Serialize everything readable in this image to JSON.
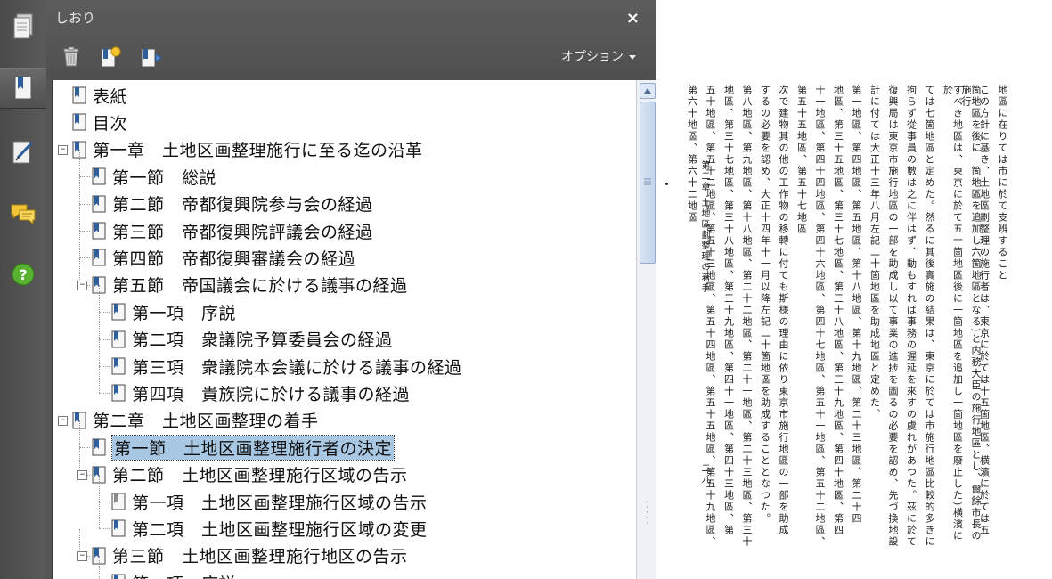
{
  "panel": {
    "title": "しおり",
    "close_label": "×",
    "options_label": "オプション"
  },
  "sidebar": {
    "icons": [
      "pages-icon",
      "bookmarks-icon",
      "signature-icon",
      "comments-icon",
      "help-icon"
    ]
  },
  "toolbar": {
    "icons": [
      "delete-icon",
      "new-bookmark-icon",
      "expand-bookmark-icon"
    ]
  },
  "tree": {
    "items": [
      {
        "label": "表紙",
        "level": 0,
        "expander": "",
        "icon": "bookmark"
      },
      {
        "label": "目次",
        "level": 0,
        "expander": "",
        "icon": "bookmark"
      },
      {
        "label": "第一章　土地区画整理施行に至る迄の沿革",
        "level": 0,
        "expander": "−",
        "icon": "bookmark"
      },
      {
        "label": "第一節　総説",
        "level": 1,
        "expander": "",
        "icon": "bookmark"
      },
      {
        "label": "第二節　帝都復興院参与会の経過",
        "level": 1,
        "expander": "",
        "icon": "bookmark"
      },
      {
        "label": "第三節　帝都復興院評議会の経過",
        "level": 1,
        "expander": "",
        "icon": "bookmark"
      },
      {
        "label": "第四節　帝都復興審議会の経過",
        "level": 1,
        "expander": "",
        "icon": "bookmark"
      },
      {
        "label": "第五節　帝国議会に於ける議事の経過",
        "level": 1,
        "expander": "−",
        "icon": "bookmark"
      },
      {
        "label": "第一項　序説",
        "level": 2,
        "expander": "",
        "icon": "bookmark"
      },
      {
        "label": "第二項　衆議院予算委員会の経過",
        "level": 2,
        "expander": "",
        "icon": "bookmark"
      },
      {
        "label": "第三項　衆議院本会議に於ける議事の経過",
        "level": 2,
        "expander": "",
        "icon": "bookmark"
      },
      {
        "label": "第四項　貴族院に於ける議事の経過",
        "level": 2,
        "expander": "",
        "icon": "bookmark"
      },
      {
        "label": "第二章　土地区画整理の着手",
        "level": 0,
        "expander": "−",
        "icon": "bookmark"
      },
      {
        "label": "第一節　土地区画整理施行者の決定",
        "level": 1,
        "expander": "",
        "icon": "bookmark",
        "selected": true
      },
      {
        "label": "第二節　土地区画整理施行区域の告示",
        "level": 1,
        "expander": "−",
        "icon": "bookmark"
      },
      {
        "label": "第一項　土地区画整理施行区域の告示",
        "level": 2,
        "expander": "",
        "icon": "bookmark-gray"
      },
      {
        "label": "第二項　土地区画整理施行区域の変更",
        "level": 2,
        "expander": "",
        "icon": "bookmark"
      },
      {
        "label": "第三節　土地区画整理施行地区の告示",
        "level": 1,
        "expander": "−",
        "icon": "bookmark"
      },
      {
        "label": "第一項　序説",
        "level": 2,
        "expander": "",
        "icon": "bookmark"
      }
    ]
  },
  "document": {
    "columns": [
      "地區に在りては市に於て支辨すること",
      "この方針に基き、土地區劃整理の施行者は、東京に於ては十五箇地區、横濱に於ては五",
      "箇地區を後に一箇地區を追加し六箇地區となる)と内務大臣の施行地區とし、爾餘市長の施行",
      "すべき地區は、東京に於て五十箇地區後に一箇地區を追加し一箇地區を廢止した)横濱に於",
      "ては七箇地區と定めた。然るに其後實施の結果は、東京に於ては市施行地區比較的多きに",
      "拘らず從事員の數は之に伴はず、動もすれば事務の遲延を來すの虞れがあつた。茲に於て",
      "復興局は東京市施行地區の一部を助成し以て事業の進捗を圖るの必要を認め、先づ換地設",
      "計に付ては大正十三年八月左記二十箇地區を助成地區と定めた。",
      "第一地區、第四地區、第五地區、第十八地區、第十九地區、第二十三地區、第二十四",
      "地區、第三十五地區、第三十七地區、第三十八地區、第三十九地區、第四十地區、第四",
      "十一地區、第四十四地區、第四十六地區、第四十七地區、第五十一地區、第五十二地區、",
      "第五十五地區、第五十七地區",
      "次で建物其の他の工作物の移轉に付ても斯様の理由に依り東京市施行地區の一部を助成",
      "するの必要を認め、大正十四年十一月以降左記二十箇地區を助成することとなつた。",
      "第八地區、第九地區、第十八地區、第二十二地區、第二十一地區、第二十三地區、第三十",
      "地區、第三十七地區、第三十八地區、第三十九地區、第四十一地區、第四十三地區、第",
      "五十地區、第五十二地區、第五十三地區、第五十四地區、第五十五地區、第五十九地區、",
      "第六十地區、第六十二地區"
    ],
    "running_head": [
      "第二章",
      "土地區劃整理の着手"
    ],
    "page_number": "二九"
  },
  "colors": {
    "sidebar": "#4f4f4f",
    "panel": "#555555",
    "selection": "#a8c7e3",
    "bookmark_icon": "#2f5f9a"
  }
}
